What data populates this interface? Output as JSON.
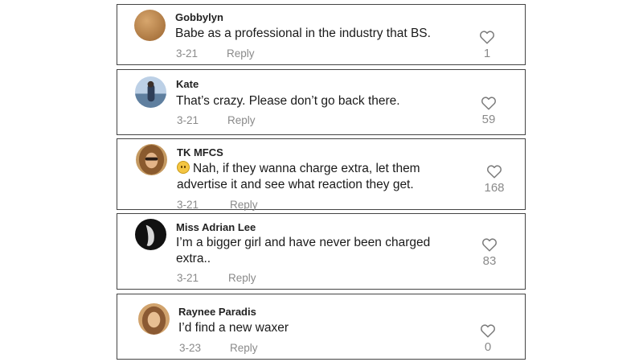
{
  "comments": [
    {
      "author": "Gobbylyn",
      "text_lines": [
        "Babe as a professional in the industry that BS."
      ],
      "date": "3-21",
      "reply_label": "Reply",
      "likes": "1",
      "avatar_icon": "avatar-gobbylyn"
    },
    {
      "author": "Kate",
      "text_lines": [
        "That’s crazy. Please don’t go back there."
      ],
      "date": "3-21",
      "reply_label": "Reply",
      "likes": "59",
      "avatar_icon": "avatar-kate"
    },
    {
      "author": "TK MFCS",
      "emoji": "face-with-open-eyes-and-hand-over-mouth-emoji",
      "text_lines": [
        "Nah, if they wanna charge extra, let them",
        "advertise it and see what reaction they get."
      ],
      "date": "3-21",
      "reply_label": "Reply",
      "likes": "168",
      "avatar_icon": "avatar-tk-mfcs"
    },
    {
      "author": "Miss Adrian Lee",
      "text_lines": [
        "I’m a bigger girl and have never been charged",
        "extra.."
      ],
      "date": "3-21",
      "reply_label": "Reply",
      "likes": "83",
      "avatar_icon": "avatar-miss-adrian-lee"
    },
    {
      "author": "Raynee Paradis",
      "text_lines": [
        "I’d find a new waxer"
      ],
      "date": "3-23",
      "reply_label": "Reply",
      "likes": "0",
      "avatar_icon": "avatar-raynee-paradis"
    }
  ],
  "colors": {
    "meta_gray": "#8a8a8a",
    "border": "#444444",
    "text": "#1a1a1a"
  }
}
